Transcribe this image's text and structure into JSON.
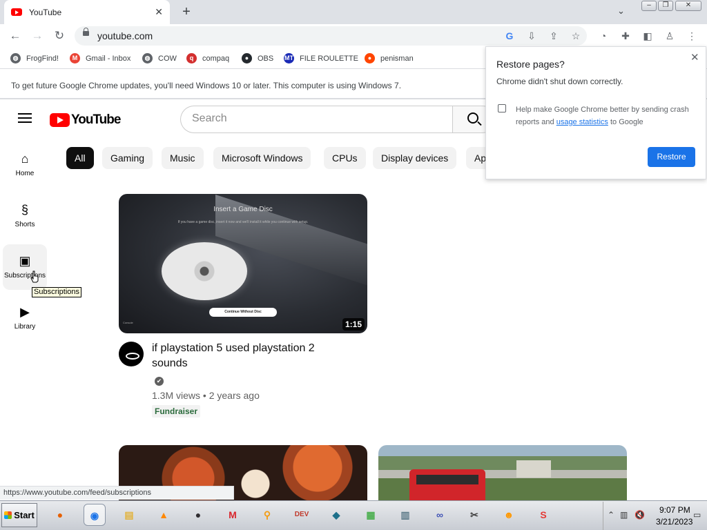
{
  "browser": {
    "tab_title": "YouTube",
    "tab_close": "✕",
    "new_tab": "+",
    "tab_search": "⌄",
    "url": "youtube.com",
    "window_controls": {
      "minimize": "–",
      "restore": "❐",
      "close": "✕"
    }
  },
  "bookmarks": [
    {
      "label": "FrogFind!",
      "icon": "globe-icon",
      "glyph": "◍",
      "color": "#5f6368"
    },
    {
      "label": "Gmail - Inbox",
      "icon": "gmail-icon",
      "glyph": "M",
      "color": "#ea4335"
    },
    {
      "label": "COW",
      "icon": "globe-icon",
      "glyph": "◍",
      "color": "#5f6368"
    },
    {
      "label": "compaq",
      "icon": "compaq-icon",
      "glyph": "q",
      "color": "#d32f2f"
    },
    {
      "label": "OBS",
      "icon": "github-icon",
      "glyph": "●",
      "color": "#24292e"
    },
    {
      "label": "FILE ROULETTE",
      "icon": "file-roulette-icon",
      "glyph": "MT",
      "color": "#1a2ab5"
    },
    {
      "label": "penisman",
      "icon": "reddit-icon",
      "glyph": "●",
      "color": "#ff4500"
    }
  ],
  "infobar": {
    "text": "To get future Google Chrome updates, you'll need Windows 10 or later. This computer is using Windows 7."
  },
  "youtube": {
    "logo_text": "YouTube",
    "search_placeholder": "Search",
    "nav": [
      {
        "label": "Home",
        "icon": "home-icon",
        "glyph": "⌂"
      },
      {
        "label": "Shorts",
        "icon": "shorts-icon",
        "glyph": "§"
      },
      {
        "label": "Subscriptions",
        "icon": "subscriptions-icon",
        "glyph": "▣"
      },
      {
        "label": "Library",
        "icon": "library-icon",
        "glyph": "▶"
      }
    ],
    "chips": [
      "All",
      "Gaming",
      "Music",
      "Microsoft Windows",
      "CPUs",
      "Display devices",
      "Ap"
    ],
    "video": {
      "title": "if playstation 5 used playstation 2 sounds",
      "duration": "1:15",
      "meta": "1.3M views • 2 years ago",
      "badge": "Fundraiser",
      "verified": "✔",
      "thumb_title": "Insert a Game Disc",
      "thumb_subtitle": "If you have a game disc, insert it now and we'll install it while you continue with setup.",
      "thumb_button": "Continue Without Disc",
      "thumb_corner": "Console"
    }
  },
  "tooltip": "Subscriptions",
  "status_url": "https://www.youtube.com/feed/subscriptions",
  "restore_popup": {
    "title": "Restore pages?",
    "description": "Chrome didn't shut down correctly.",
    "checkbox_text_before": "Help make Google Chrome better by sending crash reports and ",
    "checkbox_link": "usage statistics",
    "checkbox_text_after": " to Google",
    "button": "Restore",
    "close": "✕"
  },
  "taskbar": {
    "start_label": "Start",
    "apps": [
      {
        "name": "firefox-icon",
        "glyph": "●",
        "color": "#e66000"
      },
      {
        "name": "chrome-icon",
        "glyph": "◉",
        "color": "#1a73e8"
      },
      {
        "name": "explorer-icon",
        "glyph": "▤",
        "color": "#e2b33d"
      },
      {
        "name": "vlc-icon",
        "glyph": "▲",
        "color": "#ff8800"
      },
      {
        "name": "obs-icon",
        "glyph": "●",
        "color": "#302e31"
      },
      {
        "name": "mega-icon",
        "glyph": "M",
        "color": "#d9272e"
      },
      {
        "name": "search-app-icon",
        "glyph": "⚲",
        "color": "#f39c12"
      },
      {
        "name": "devcpp-icon",
        "glyph": "DEV",
        "color": "#c0392b"
      },
      {
        "name": "filmora-icon",
        "glyph": "◆",
        "color": "#1d6f8a"
      },
      {
        "name": "notepad-icon",
        "glyph": "▦",
        "color": "#4caf50"
      },
      {
        "name": "window-app-icon",
        "glyph": "▥",
        "color": "#607d8b"
      },
      {
        "name": "infinity-icon",
        "glyph": "∞",
        "color": "#3f51b5"
      },
      {
        "name": "tools-icon",
        "glyph": "✂",
        "color": "#424242"
      },
      {
        "name": "crash-icon",
        "glyph": "☻",
        "color": "#ff9800"
      },
      {
        "name": "s-app-icon",
        "glyph": "S",
        "color": "#e53935"
      }
    ],
    "time": "9:07 PM",
    "date": "3/21/2023"
  }
}
